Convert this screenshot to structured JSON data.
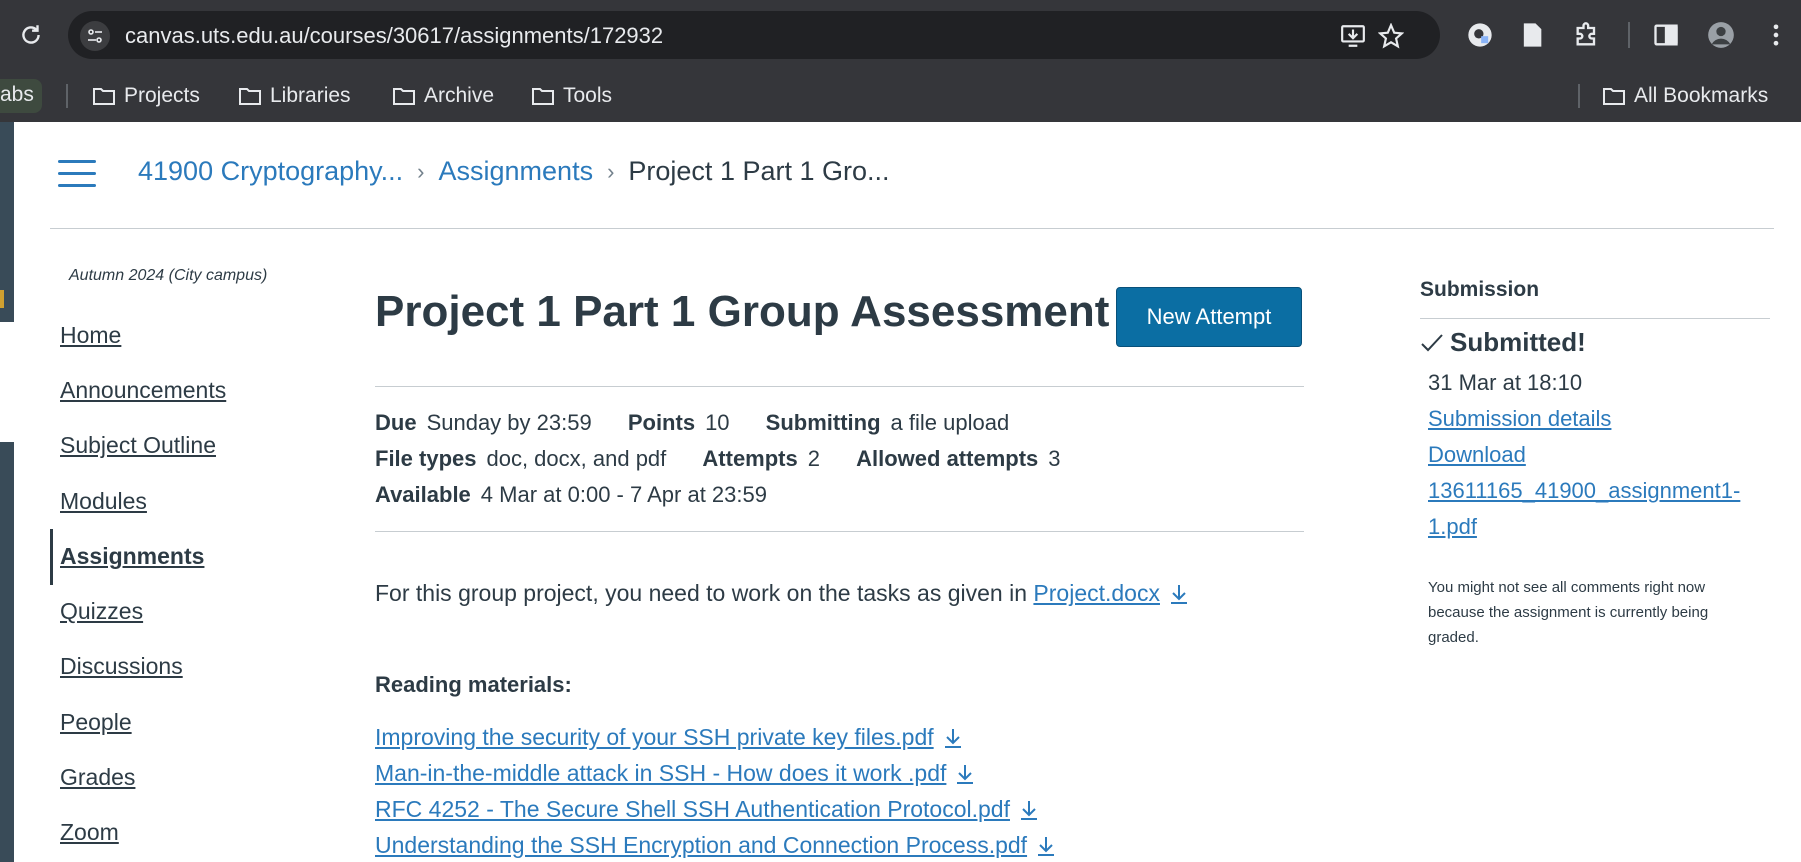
{
  "browser": {
    "url": "canvas.uts.edu.au/courses/30617/assignments/172932",
    "bookmarks": {
      "tab_fragment": "abs",
      "items": [
        "Projects",
        "Libraries",
        "Archive",
        "Tools"
      ],
      "all_bookmarks": "All Bookmarks"
    }
  },
  "header": {
    "breadcrumbs": [
      "41900 Cryptography...",
      "Assignments",
      "Project 1 Part 1 Gro..."
    ]
  },
  "course_nav": {
    "term": "Autumn 2024 (City campus)",
    "items": [
      "Home",
      "Announcements",
      "Subject Outline",
      "Modules",
      "Assignments",
      "Quizzes",
      "Discussions",
      "People",
      "Grades",
      "Zoom"
    ],
    "active": "Assignments"
  },
  "assignment": {
    "title": "Project 1 Part 1 Group Assessment",
    "new_attempt_label": "New Attempt",
    "details": {
      "due_label": "Due",
      "due_value": "Sunday by 23:59",
      "points_label": "Points",
      "points_value": "10",
      "submitting_label": "Submitting",
      "submitting_value": "a file upload",
      "file_types_label": "File types",
      "file_types_value": "doc, docx, and pdf",
      "attempts_label": "Attempts",
      "attempts_value": "2",
      "allowed_attempts_label": "Allowed attempts",
      "allowed_attempts_value": "3",
      "available_label": "Available",
      "available_value": "4 Mar at 0:00 - 7 Apr at 23:59"
    },
    "intro_text": "For this group project, you need to work on the tasks as given in",
    "intro_link": "Project.docx",
    "reading_heading": "Reading materials:",
    "reading_files": [
      "Improving the security of your SSH private key files.pdf",
      "Man-in-the-middle attack in SSH - How does it work .pdf",
      "RFC 4252 - The Secure Shell  SSH  Authentication Protocol.pdf",
      "Understanding the SSH Encryption and Connection Process.pdf"
    ]
  },
  "submission": {
    "heading": "Submission",
    "status": "Submitted!",
    "date": "31 Mar at 18:10",
    "details_link": "Submission details",
    "download_link": "Download",
    "file_line1": "13611165_41900_assignment1-",
    "file_line2": "1.pdf",
    "note": "You might not see all comments right now because the assignment is currently being graded."
  },
  "colors": {
    "link": "#2b7abc",
    "button": "#0b6ea3",
    "text": "#2d3b45",
    "chrome": "#35363a"
  }
}
